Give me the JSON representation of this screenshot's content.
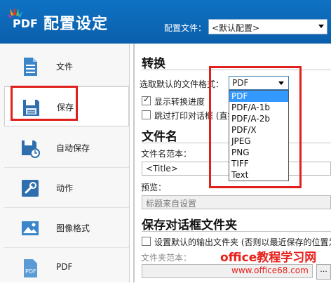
{
  "header": {
    "logo_text": "PDF",
    "title": "配置设定",
    "config_label": "配置文件：",
    "config_value": "<默认配置>"
  },
  "sidebar": {
    "items": [
      {
        "label": "文件",
        "icon": "document-icon"
      },
      {
        "label": "保存",
        "icon": "save-icon"
      },
      {
        "label": "自动保存",
        "icon": "autosave-icon"
      },
      {
        "label": "动作",
        "icon": "wrench-icon"
      },
      {
        "label": "图像格式",
        "icon": "image-icon"
      },
      {
        "label": "PDF",
        "icon": "pdf-file-icon"
      }
    ]
  },
  "convert": {
    "title": "转换",
    "format_label": "选取默认的文件格式：",
    "format_value": "PDF",
    "format_options": [
      "PDF",
      "PDF/A-1b",
      "PDF/A-2b",
      "PDF/X",
      "JPEG",
      "PNG",
      "TIFF",
      "Text"
    ],
    "show_progress_label": "显示转换进度",
    "show_progress_checked": true,
    "skip_print_label": "跳过打印对话框 (直接",
    "skip_print_checked": false
  },
  "filename": {
    "title": "文件名",
    "template_label": "文件名范本：",
    "template_value": "<Title>",
    "preview_label": "预览：",
    "preview_value": "标题来自设置"
  },
  "save_dialog": {
    "title": "保存对话框文件夹",
    "default_folder_label": "设置默认的输出文件夹 (否则以最近保存的位置为",
    "default_folder_checked": false,
    "folder_template_label": "文件夹范本：",
    "browse_label": "..."
  },
  "watermark": {
    "line1": "office教程学习网",
    "line2": "www.office68.com"
  },
  "colors": {
    "header_blue": "#0a5fab",
    "highlight_red": "#e0201c",
    "selection_blue": "#3399ff"
  }
}
